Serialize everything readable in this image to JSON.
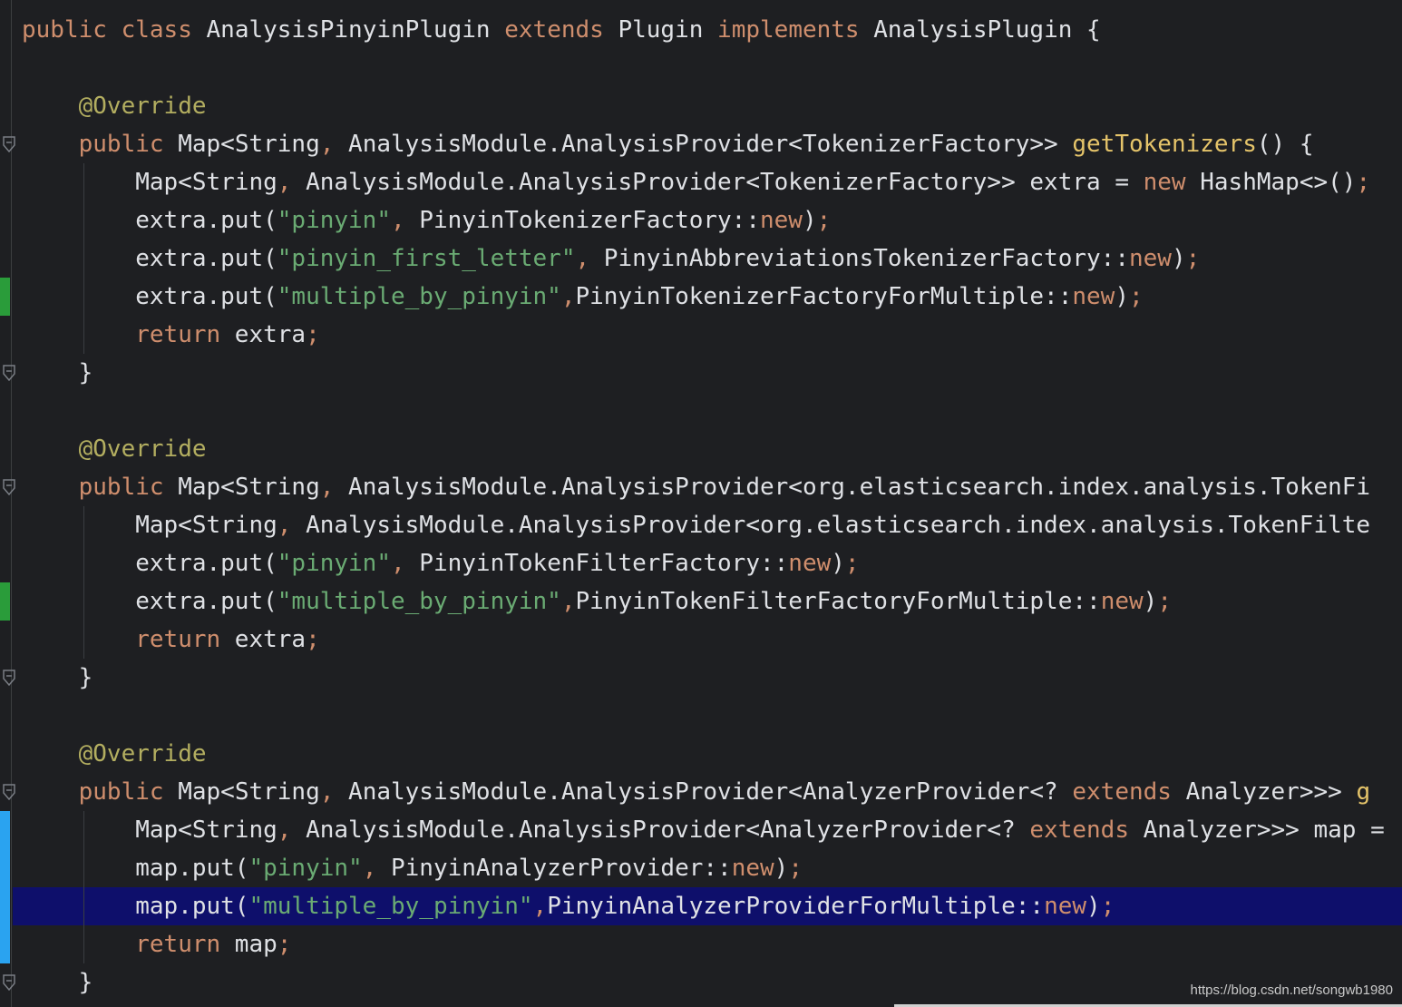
{
  "editor": {
    "lines": [
      [
        [
          "kw",
          "public"
        ],
        [
          "plain",
          " "
        ],
        [
          "kw",
          "class"
        ],
        [
          "plain",
          " AnalysisPinyinPlugin "
        ],
        [
          "kw",
          "extends"
        ],
        [
          "plain",
          " Plugin "
        ],
        [
          "kw",
          "implements"
        ],
        [
          "plain",
          " AnalysisPlugin {"
        ]
      ],
      [],
      [
        [
          "plain",
          "    "
        ],
        [
          "ann",
          "@Override"
        ]
      ],
      [
        [
          "plain",
          "    "
        ],
        [
          "kw",
          "public"
        ],
        [
          "plain",
          " Map<String"
        ],
        [
          "punc",
          ","
        ],
        [
          "plain",
          " AnalysisModule.AnalysisProvider<TokenizerFactory>> "
        ],
        [
          "fn",
          "getTokenizers"
        ],
        [
          "plain",
          "() {"
        ]
      ],
      [
        [
          "plain",
          "        Map<String"
        ],
        [
          "punc",
          ","
        ],
        [
          "plain",
          " AnalysisModule.AnalysisProvider<TokenizerFactory>> extra = "
        ],
        [
          "kw",
          "new"
        ],
        [
          "plain",
          " HashMap<>()"
        ],
        [
          "punc",
          ";"
        ]
      ],
      [
        [
          "plain",
          "        extra.put("
        ],
        [
          "str",
          "\"pinyin\""
        ],
        [
          "punc",
          ","
        ],
        [
          "plain",
          " PinyinTokenizerFactory::"
        ],
        [
          "kw",
          "new"
        ],
        [
          "plain",
          ")"
        ],
        [
          "punc",
          ";"
        ]
      ],
      [
        [
          "plain",
          "        extra.put("
        ],
        [
          "str",
          "\"pinyin_first_letter\""
        ],
        [
          "punc",
          ","
        ],
        [
          "plain",
          " PinyinAbbreviationsTokenizerFactory::"
        ],
        [
          "kw",
          "new"
        ],
        [
          "plain",
          ")"
        ],
        [
          "punc",
          ";"
        ]
      ],
      [
        [
          "plain",
          "        extra.put("
        ],
        [
          "str",
          "\"multiple_by_pinyin\""
        ],
        [
          "punc",
          ","
        ],
        [
          "plain",
          "PinyinTokenizerFactoryForMultiple::"
        ],
        [
          "kw",
          "new"
        ],
        [
          "plain",
          ")"
        ],
        [
          "punc",
          ";"
        ]
      ],
      [
        [
          "plain",
          "        "
        ],
        [
          "kw",
          "return"
        ],
        [
          "plain",
          " extra"
        ],
        [
          "punc",
          ";"
        ]
      ],
      [
        [
          "plain",
          "    }"
        ]
      ],
      [],
      [
        [
          "plain",
          "    "
        ],
        [
          "ann",
          "@Override"
        ]
      ],
      [
        [
          "plain",
          "    "
        ],
        [
          "kw",
          "public"
        ],
        [
          "plain",
          " Map<String"
        ],
        [
          "punc",
          ","
        ],
        [
          "plain",
          " AnalysisModule.AnalysisProvider<org.elasticsearch.index.analysis.TokenFi"
        ]
      ],
      [
        [
          "plain",
          "        Map<String"
        ],
        [
          "punc",
          ","
        ],
        [
          "plain",
          " AnalysisModule.AnalysisProvider<org.elasticsearch.index.analysis.TokenFilte"
        ]
      ],
      [
        [
          "plain",
          "        extra.put("
        ],
        [
          "str",
          "\"pinyin\""
        ],
        [
          "punc",
          ","
        ],
        [
          "plain",
          " PinyinTokenFilterFactory::"
        ],
        [
          "kw",
          "new"
        ],
        [
          "plain",
          ")"
        ],
        [
          "punc",
          ";"
        ]
      ],
      [
        [
          "plain",
          "        extra.put("
        ],
        [
          "str",
          "\"multiple_by_pinyin\""
        ],
        [
          "punc",
          ","
        ],
        [
          "plain",
          "PinyinTokenFilterFactoryForMultiple::"
        ],
        [
          "kw",
          "new"
        ],
        [
          "plain",
          ")"
        ],
        [
          "punc",
          ";"
        ]
      ],
      [
        [
          "plain",
          "        "
        ],
        [
          "kw",
          "return"
        ],
        [
          "plain",
          " extra"
        ],
        [
          "punc",
          ";"
        ]
      ],
      [
        [
          "plain",
          "    }"
        ]
      ],
      [],
      [
        [
          "plain",
          "    "
        ],
        [
          "ann",
          "@Override"
        ]
      ],
      [
        [
          "plain",
          "    "
        ],
        [
          "kw",
          "public"
        ],
        [
          "plain",
          " Map<String"
        ],
        [
          "punc",
          ","
        ],
        [
          "plain",
          " AnalysisModule.AnalysisProvider<AnalyzerProvider<? "
        ],
        [
          "kw",
          "extends"
        ],
        [
          "plain",
          " Analyzer>>> "
        ],
        [
          "fn",
          "g"
        ]
      ],
      [
        [
          "plain",
          "        Map<String"
        ],
        [
          "punc",
          ","
        ],
        [
          "plain",
          " AnalysisModule.AnalysisProvider<AnalyzerProvider<? "
        ],
        [
          "kw",
          "extends"
        ],
        [
          "plain",
          " Analyzer>>> map ="
        ]
      ],
      [
        [
          "plain",
          "        map.put("
        ],
        [
          "str",
          "\"pinyin\""
        ],
        [
          "punc",
          ","
        ],
        [
          "plain",
          " PinyinAnalyzerProvider::"
        ],
        [
          "kw",
          "new"
        ],
        [
          "plain",
          ")"
        ],
        [
          "punc",
          ";"
        ]
      ],
      [
        [
          "plain",
          "        map.put("
        ],
        [
          "str",
          "\"multiple_by_pinyin\""
        ],
        [
          "punc",
          ","
        ],
        [
          "plain",
          "PinyinAnalyzerProviderForMultiple::"
        ],
        [
          "kw",
          "new"
        ],
        [
          "plain",
          ")"
        ],
        [
          "punc",
          ";"
        ]
      ],
      [
        [
          "plain",
          "        "
        ],
        [
          "kw",
          "return"
        ],
        [
          "plain",
          " map"
        ],
        [
          "punc",
          ";"
        ]
      ],
      [
        [
          "plain",
          "    }"
        ]
      ]
    ],
    "selected_line": 23
  },
  "gutter": {
    "fold_icon": "fold-marker-icon",
    "added_marker_color": "#2a9c3a",
    "modified_marker_color": "#2aa3f0"
  },
  "watermark": "https://blog.csdn.net/songwb1980"
}
